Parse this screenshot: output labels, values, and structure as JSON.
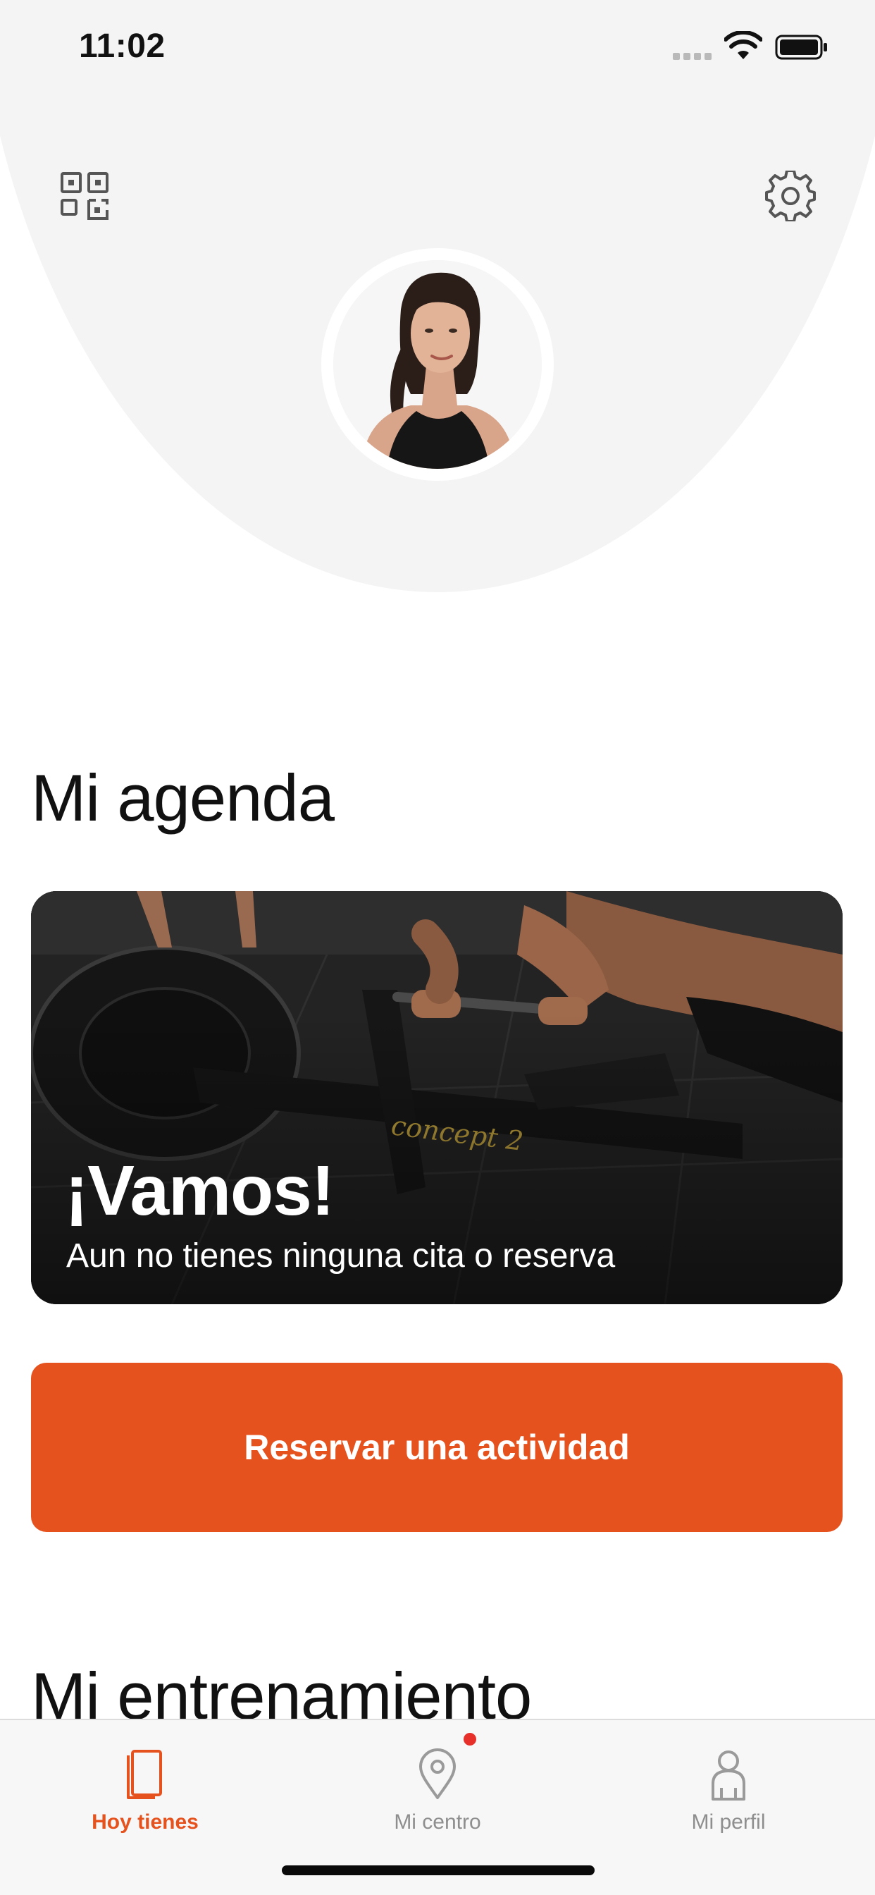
{
  "status_bar": {
    "time": "11:02"
  },
  "header": {
    "qr_icon": "qr-code-icon",
    "settings_icon": "gear-icon"
  },
  "agenda": {
    "title": "Mi agenda",
    "card_title": "¡Vamos!",
    "card_subtitle": "Aun no tienes ninguna cita o reserva",
    "card_image": "rowing-machine-photo"
  },
  "cta": {
    "label": "Reservar una actividad"
  },
  "training": {
    "title": "Mi entrenamiento"
  },
  "tab_bar": {
    "items": [
      {
        "label": "Hoy tienes",
        "icon": "notebook-icon",
        "active": true
      },
      {
        "label": "Mi centro",
        "icon": "location-pin-icon",
        "active": false,
        "badge": true
      },
      {
        "label": "Mi perfil",
        "icon": "person-icon",
        "active": false
      }
    ]
  },
  "colors": {
    "accent": "#e6521e",
    "header_bg": "#f4f4f4",
    "badge": "#e8302a"
  }
}
